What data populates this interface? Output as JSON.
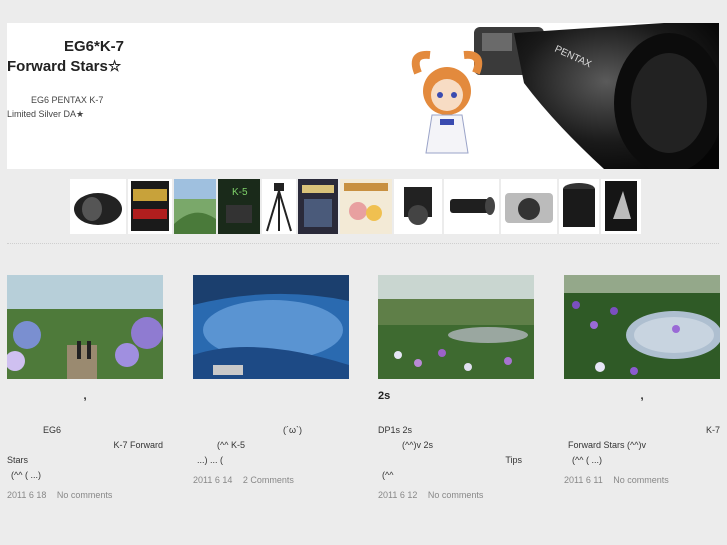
{
  "header": {
    "title_line1": "EG6*K-7",
    "title_line2": "Forward Stars☆",
    "desc_line1": "EG6     PENTAX K-7",
    "desc_line2": "Limited Silver DA★"
  },
  "thumbnails": [
    {
      "name": "fisheye-lens"
    },
    {
      "name": "sd-card"
    },
    {
      "name": "photo-book"
    },
    {
      "name": "k5-book"
    },
    {
      "name": "tripod"
    },
    {
      "name": "magazine"
    },
    {
      "name": "anime-book"
    },
    {
      "name": "camera-accessory"
    },
    {
      "name": "telephoto-lens"
    },
    {
      "name": "k5-body"
    },
    {
      "name": "zoom-lens"
    },
    {
      "name": "photo-album"
    }
  ],
  "posts": [
    {
      "title": ",",
      "lines": [
        "EG6",
        "K-7 Forward",
        "Stars",
        "(^^                    (      ...)"
      ],
      "date": "2011    6    18",
      "comments": "No comments"
    },
    {
      "title": "",
      "lines": [
        "(´ω`)",
        "(^^      K-5",
        "...)                                              ...  ("
      ],
      "date": "2011    6    14",
      "comments": "2 Comments"
    },
    {
      "title": "2s",
      "lines": [
        "DP1s                                                  2s",
        "(^^)v       2s",
        "Tips",
        "(^^"
      ],
      "date": "2011    6    12",
      "comments": "No comments"
    },
    {
      "title": ",",
      "lines": [
        "K-7",
        "Forward Stars        (^^)v",
        "(^^                    (      ...)"
      ],
      "date": "2011    6    11",
      "comments": "No comments"
    }
  ]
}
